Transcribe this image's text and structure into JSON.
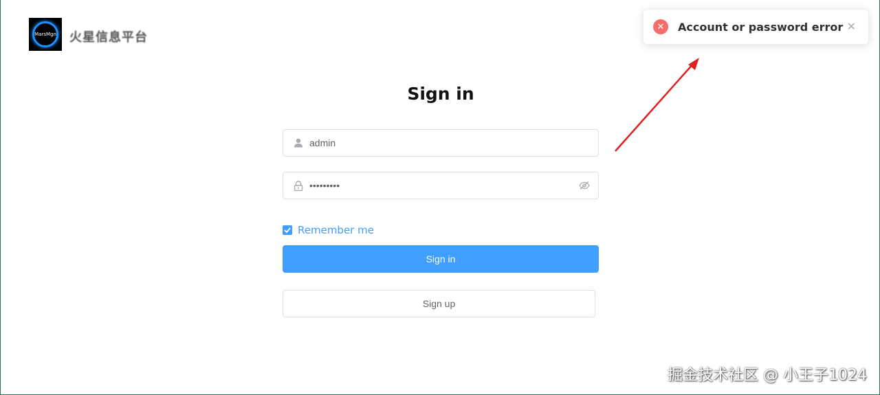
{
  "header": {
    "logo_text": "MarsMgn",
    "brand_name": "火星信息平台"
  },
  "toast": {
    "type": "error",
    "message": "Account or password error",
    "icon": "error-x-icon",
    "close_icon": "close-icon"
  },
  "form": {
    "title": "Sign in",
    "username": {
      "value": "admin",
      "icon": "user-icon"
    },
    "password": {
      "value": "•••••••••",
      "icon": "lock-icon",
      "suffix_icon": "eye-hidden-icon"
    },
    "remember": {
      "label": "Remember me",
      "checked": true
    },
    "signin_label": "Sign in",
    "signup_label": "Sign up"
  },
  "watermark": "掘金技术社区 @ 小王子1024",
  "colors": {
    "primary": "#409eff",
    "error": "#f56c6c",
    "annotation_arrow": "#e02020"
  }
}
